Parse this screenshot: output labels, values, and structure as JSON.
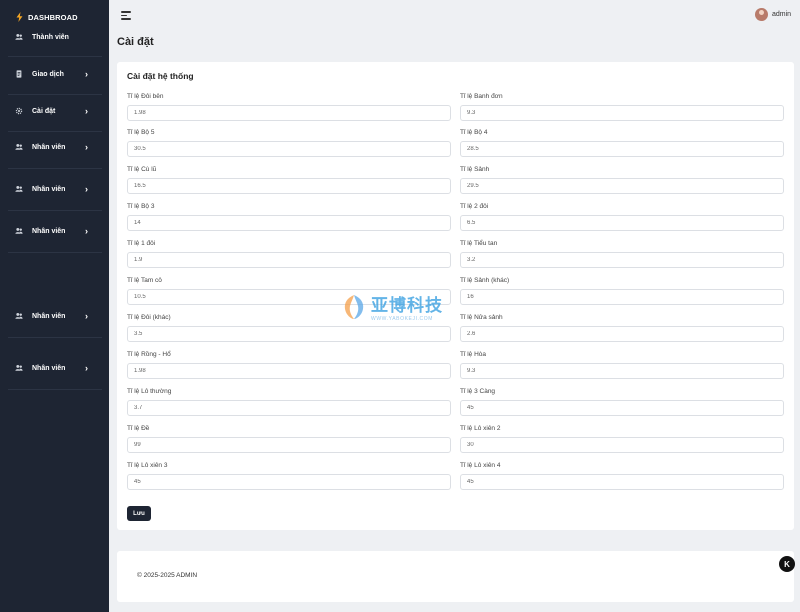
{
  "sidebar": {
    "brand": "DASHBROAD",
    "items": [
      {
        "label": "Thành viên",
        "icon": "users-icon",
        "chevron": false
      },
      {
        "label": "Giao dịch",
        "icon": "receipt-icon",
        "chevron": true
      },
      {
        "label": "Cài đặt",
        "icon": "gear-icon",
        "chevron": true
      },
      {
        "label": "Nhân viên",
        "icon": "users-icon",
        "chevron": true
      },
      {
        "label": "Nhân viên",
        "icon": "users-icon",
        "chevron": true
      },
      {
        "label": "Nhân viên",
        "icon": "users-icon",
        "chevron": true
      },
      {
        "label": "Nhân viên",
        "icon": "users-icon",
        "chevron": true
      },
      {
        "label": "Nhân viên",
        "icon": "users-icon",
        "chevron": true
      }
    ]
  },
  "header": {
    "user_name": "admin"
  },
  "page": {
    "title": "Cài đặt"
  },
  "settings": {
    "title": "Cài đặt hệ thống",
    "fields": [
      {
        "label": "Tỉ lệ Đôi bên",
        "value": "1.98"
      },
      {
        "label": "Tỉ lệ Banh đơn",
        "value": "9.3"
      },
      {
        "label": "Tỉ lệ Bộ 5",
        "value": "30.5"
      },
      {
        "label": "Tỉ lệ Bộ 4",
        "value": "28.5"
      },
      {
        "label": "Tỉ lệ Cù lũ",
        "value": "16.5"
      },
      {
        "label": "Tỉ lệ Sảnh",
        "value": "29.5"
      },
      {
        "label": "Tỉ lệ Bộ 3",
        "value": "14"
      },
      {
        "label": "Tỉ lệ 2 đôi",
        "value": "6.5"
      },
      {
        "label": "Tỉ lệ 1 đôi",
        "value": "1.9"
      },
      {
        "label": "Tỉ lệ Tiểu tan",
        "value": "3.2"
      },
      {
        "label": "Tỉ lệ Tam cô",
        "value": "10.5"
      },
      {
        "label": "Tỉ lệ Sảnh (khác)",
        "value": "16"
      },
      {
        "label": "Tỉ lệ Đôi (khác)",
        "value": "3.5"
      },
      {
        "label": "Tỉ lệ Nửa sảnh",
        "value": "2.6"
      },
      {
        "label": "Tỉ lệ Rồng - Hổ",
        "value": "1.98"
      },
      {
        "label": "Tỉ lệ Hòa",
        "value": "9.3"
      },
      {
        "label": "Tỉ lệ Lô thường",
        "value": "3.7"
      },
      {
        "label": "Tỉ lệ 3 Càng",
        "value": "45"
      },
      {
        "label": "Tỉ lệ Đề",
        "value": "99"
      },
      {
        "label": "Tỉ lệ Lô xiên 2",
        "value": "30"
      },
      {
        "label": "Tỉ lệ Lô xiên 3",
        "value": "45"
      },
      {
        "label": "Tỉ lệ Lô xiên 4",
        "value": "45"
      }
    ],
    "save_label": "Lưu"
  },
  "watermark": {
    "cn": "亚博科技",
    "en": "WWW.YABOKEJI.COM"
  },
  "footer": {
    "text": "© 2025-2025 ADMIN"
  },
  "corner_badge": {
    "letter": "K"
  },
  "colors": {
    "sidebar_bg": "#1e2533",
    "page_bg": "#eef0f3",
    "accent": "#1e2533",
    "watermark": "#2f9be0"
  }
}
